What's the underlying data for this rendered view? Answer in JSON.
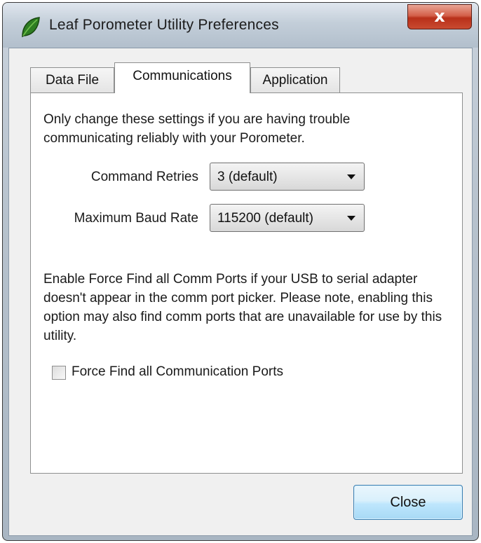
{
  "window": {
    "title": "Leaf Porometer Utility Preferences",
    "close_glyph": "x",
    "icon": "leaf-icon"
  },
  "tabs": [
    {
      "label": "Data File",
      "active": false
    },
    {
      "label": "Communications",
      "active": true
    },
    {
      "label": "Application",
      "active": false
    }
  ],
  "communications": {
    "intro_text": "Only change these settings if you are having trouble communicating reliably with your Porometer.",
    "command_retries": {
      "label": "Command Retries",
      "value": "3 (default)"
    },
    "max_baud_rate": {
      "label": "Maximum Baud Rate",
      "value": "115200 (default)"
    },
    "force_find_text": "Enable Force Find all Comm Ports if your USB to serial adapter doesn't appear in the comm port picker. Please note, enabling this option may also find comm ports that are unavailable for use by this utility.",
    "force_find_checkbox": {
      "label": "Force Find all Communication Ports",
      "checked": false
    }
  },
  "footer": {
    "close_label": "Close"
  },
  "colors": {
    "leaf_green": "#2e7d22",
    "close_red": "#c94a30",
    "button_blue": "#bee6fd"
  }
}
